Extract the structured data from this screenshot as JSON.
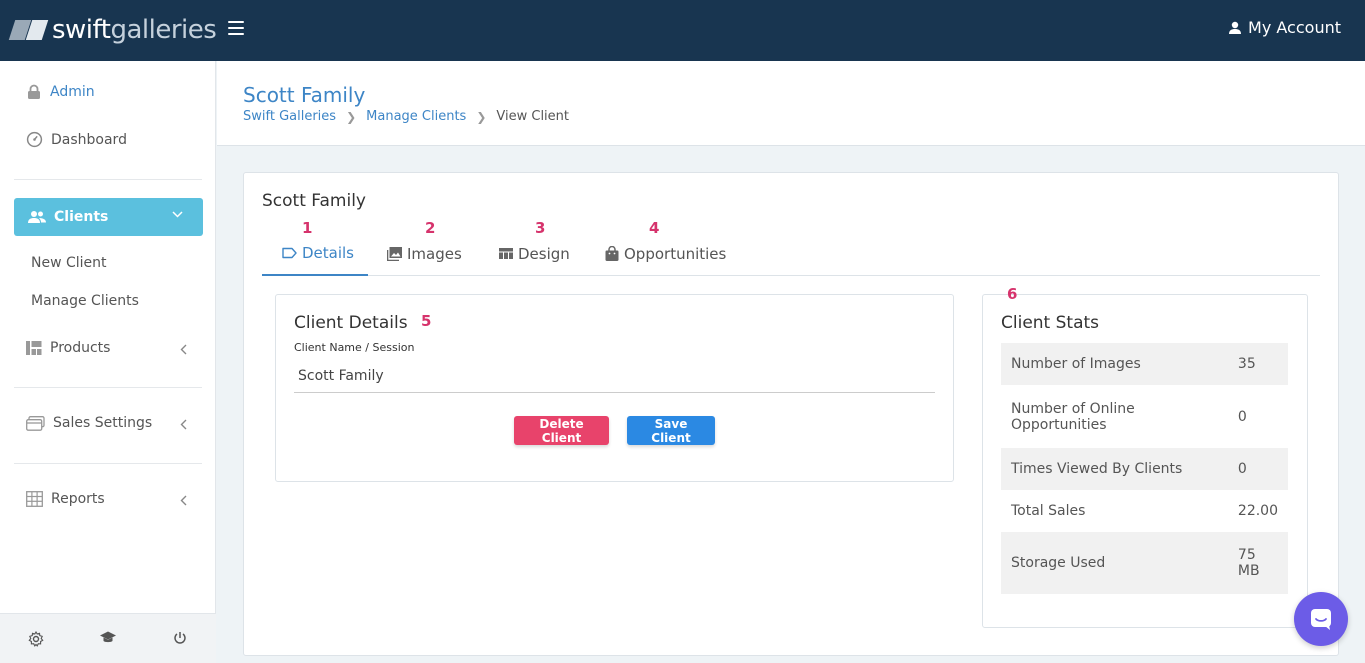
{
  "header": {
    "logo_bold": "swift",
    "logo_light": "galleries",
    "account_label": "My Account"
  },
  "sidebar": {
    "admin": "Admin",
    "dashboard": "Dashboard",
    "clients": "Clients",
    "new_client": "New Client",
    "manage_clients": "Manage Clients",
    "products": "Products",
    "sales_settings": "Sales Settings",
    "reports": "Reports"
  },
  "page": {
    "title": "Scott Family",
    "breadcrumb": [
      "Swift Galleries",
      "Manage Clients",
      "View Client"
    ]
  },
  "card": {
    "title": "Scott Family",
    "tabs": [
      {
        "label": "Details",
        "badge": "1"
      },
      {
        "label": "Images",
        "badge": "2"
      },
      {
        "label": "Design",
        "badge": "3"
      },
      {
        "label": "Opportunities",
        "badge": "4"
      }
    ]
  },
  "client_details": {
    "title": "Client Details",
    "badge": "5",
    "field_label": "Client Name / Session",
    "field_value": "Scott Family",
    "delete_label": "Delete Client",
    "save_label": "Save Client"
  },
  "client_stats": {
    "title": "Client Stats",
    "badge": "6",
    "rows": [
      {
        "label": "Number of Images",
        "value": "35"
      },
      {
        "label": "Number of Online Opportunities",
        "value": "0"
      },
      {
        "label": "Times Viewed By Clients",
        "value": "0"
      },
      {
        "label": "Total Sales",
        "value": "22.00"
      },
      {
        "label": "Storage Used",
        "value": "75 MB"
      }
    ]
  },
  "colors": {
    "topbar": "#183550",
    "accent": "#3d85c6",
    "active_nav": "#5bc0de",
    "delete": "#e8436b",
    "save": "#2b89e3",
    "badge": "#d6336c",
    "chat": "#6c5ce7"
  }
}
